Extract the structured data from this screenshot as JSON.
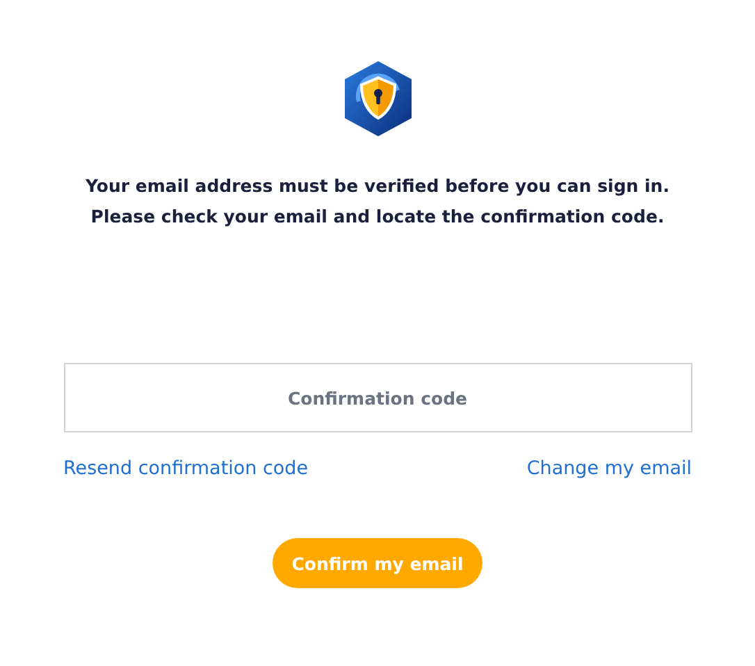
{
  "message_lines": [
    "Your email address must be verified before you can sign in.",
    "Please check your email and locate the confirmation code."
  ],
  "code_field": {
    "placeholder": "Confirmation code"
  },
  "links": [
    "Resend confirmation code",
    "Change my email"
  ],
  "confirm_button": "Confirm my email"
}
